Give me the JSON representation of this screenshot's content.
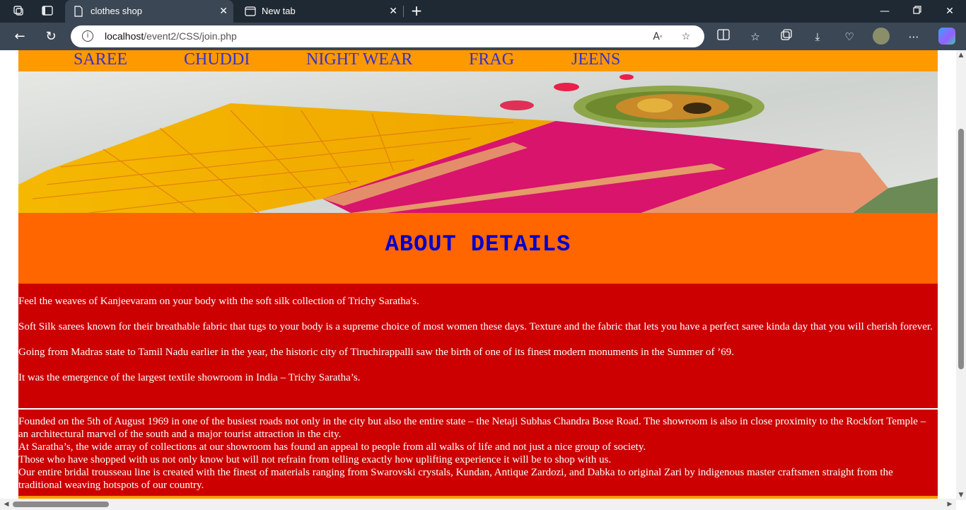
{
  "browser": {
    "tabs": [
      {
        "title": "clothes shop",
        "active": true
      },
      {
        "title": "New tab",
        "active": false
      }
    ],
    "address": {
      "host": "localhost",
      "path": "/event2/CSS/join.php"
    },
    "icons": {
      "workspaces": "workspaces-icon",
      "tab_actions": "tab-actions-icon",
      "back": "back-arrow-icon",
      "refresh": "refresh-icon",
      "info": "info-icon",
      "read_aloud": "read-aloud-icon",
      "favorite": "star-icon",
      "split": "split-screen-icon",
      "favorites": "favorites-icon",
      "collections": "collections-icon",
      "downloads": "download-icon",
      "health": "browser-essentials-icon",
      "profile": "avatar",
      "more": "more-icon",
      "copilot": "copilot-icon"
    }
  },
  "nav": {
    "items": [
      "SAREE",
      "CHUDDI",
      "NIGHT WEAR",
      "FRAG",
      "JEENS"
    ]
  },
  "about": {
    "heading": "ABOUT DETAILS",
    "intro": [
      "Feel the weaves of Kanjeevaram on your body with the soft silk collection of Trichy Saratha's.",
      "Soft Silk sarees known for their breathable fabric that tugs to your body is a supreme choice of most women these days. Texture and the fabric that lets you have a perfect saree kinda day that you will cherish forever.",
      "Going from Madras state to Tamil Nadu earlier in the year, the historic city of Tiruchirappalli saw the birth of one of its finest modern monuments in the Summer of ’69.",
      "It was the emergence of the largest textile showroom in India – Trichy Saratha’s."
    ],
    "history": [
      "Founded on the 5th of August 1969 in one of the busiest roads not only in the city but also the entire state – the Netaji Subhas Chandra Bose Road. The showroom is also in close proximity to the Rockfort Temple – an architectural marvel of the south and a major tourist attraction in the city.",
      "At Saratha’s, the wide array of collections at our showroom has found an appeal to people from all walks of life and not just a nice group of society.",
      "Those who have shopped with us not only know but will not refrain from telling exactly how uplifting experience it will be to shop with us.",
      "Our entire bridal trousseau line is created with the finest of materials ranging from Swarovski crystals, Kundan, Antique Zardozi, and Dabka to original Zari by indigenous master craftsmen straight from the traditional weaving hotspots of our country."
    ]
  },
  "colors": {
    "menu_bg": "#ff9900",
    "menu_text": "#3333cc",
    "heading_bg": "#ff6600",
    "heading_text": "#0000cc",
    "content_bg": "#cc0000"
  }
}
